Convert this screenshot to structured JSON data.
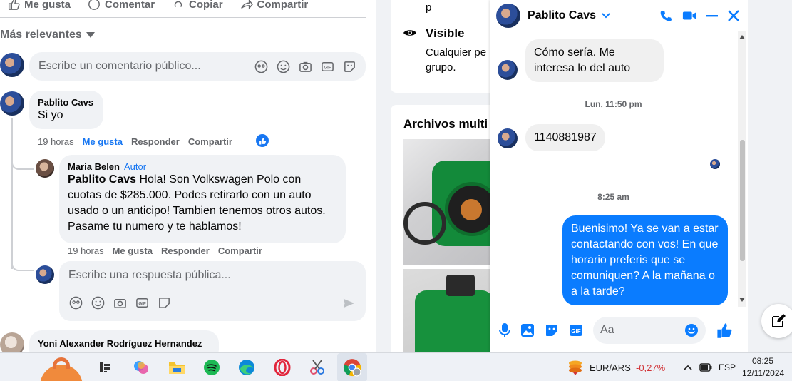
{
  "feed": {
    "actions": [
      "Me gusta",
      "Comentar",
      "Copiar",
      "Compartir"
    ],
    "sort_label": "Más relevantes",
    "comment_composer": {
      "placeholder": "Escribe un comentario público..."
    },
    "comments": [
      {
        "author": "Pablito Cavs",
        "text": "Si yo",
        "time": "19 horas",
        "like_label": "Me gusta",
        "reply_label": "Responder",
        "share_label": "Compartir"
      },
      {
        "author": "Maria Belen",
        "badge": "Autor",
        "mention": "Pablito Cavs",
        "text": " Hola! Son Volkswagen Polo con cuotas de $285.000. Podes retirarlo con un auto usado o un anticipo! Tambien tenemos otros autos. Pasame tu numero y te hablamos!",
        "time": "19 horas",
        "like_label": "Me gusta",
        "reply_label": "Responder",
        "share_label": "Compartir"
      },
      {
        "author": "Yoni Alexander Rodríguez Hernandez"
      }
    ],
    "reply_composer": {
      "placeholder": "Escribe una respuesta pública..."
    }
  },
  "middle": {
    "top_fragment": "p",
    "visible_title": "Visible",
    "visible_desc_line1": "Cualquier pe",
    "visible_desc_line2": "grupo.",
    "media_title": "Archivos multi"
  },
  "chat": {
    "name": "Pablito Cavs",
    "messages": [
      {
        "from": "in",
        "text": "Cómo sería. Me interesa lo del auto"
      },
      {
        "type": "time",
        "text": "Lun, 11:50 pm"
      },
      {
        "from": "in",
        "text": "1140881987"
      },
      {
        "type": "time",
        "text": "8:25 am"
      },
      {
        "from": "out",
        "text": "Buenisimo! Ya se van a estar contactando con vos! En que horario preferis que se comuniquen? A la mañana o a la tarde?"
      }
    ],
    "input_placeholder": "Aa"
  },
  "taskbar": {
    "ticker": {
      "pair": "EUR/ARS",
      "change": "-0,27%"
    },
    "lang": "ESP",
    "time": "08:25",
    "date": "12/11/2024"
  },
  "colors": {
    "accent": "#1877f2",
    "messenger_blue": "#0a7cff",
    "negative": "#d13438"
  }
}
